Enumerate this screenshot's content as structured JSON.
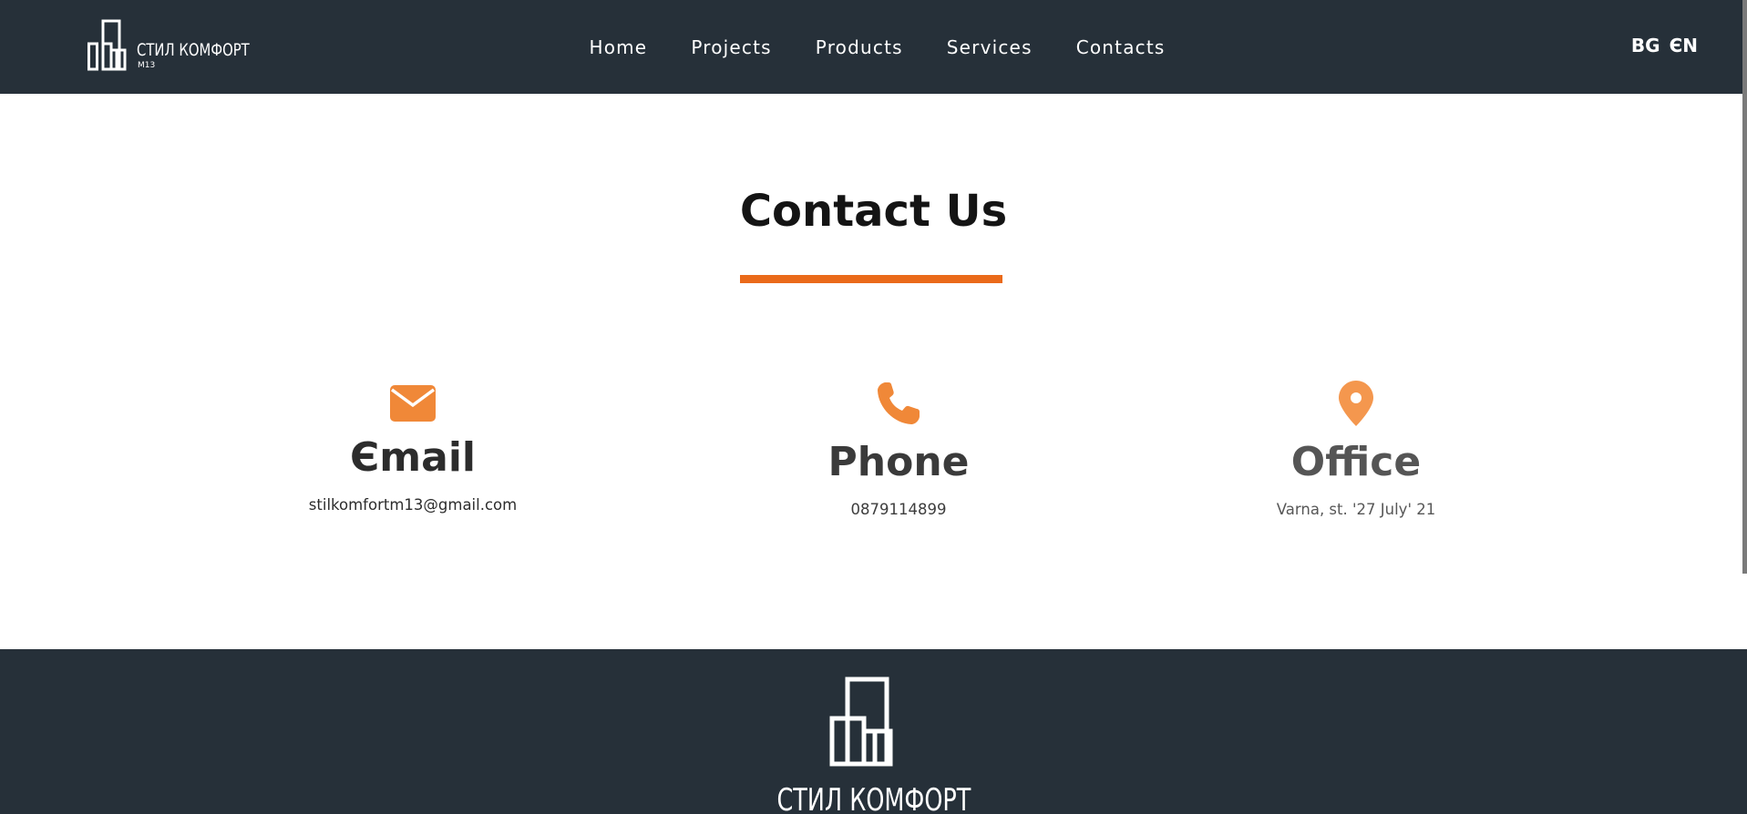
{
  "header": {
    "logo": {
      "text": "СТИЛ КОМФОРТ",
      "sub": "M13",
      "icon": "buildings-logo-icon"
    },
    "nav": [
      {
        "label": "Home"
      },
      {
        "label": "Projects"
      },
      {
        "label": "Products"
      },
      {
        "label": "Services"
      },
      {
        "label": "Contacts"
      }
    ],
    "languages": [
      "BG",
      "ЄN"
    ]
  },
  "contact": {
    "title": "Contact Us",
    "cards": [
      {
        "icon": "envelope-icon",
        "title": "Єmail",
        "value": "stilkomfortm13@gmail.com"
      },
      {
        "icon": "phone-icon",
        "title": "Phone",
        "value": "0879114899"
      },
      {
        "icon": "map-pin-icon",
        "title": "Office",
        "value": "Varna, st. '27 July' 21"
      }
    ]
  },
  "footer": {
    "logo_text": "СТИЛ КОМФОРТ",
    "icon": "buildings-logo-icon"
  },
  "colors": {
    "header_bg": "#263039",
    "accent": "#ea6a1a",
    "icon_orange": "#f08838",
    "footer_bg": "#263039"
  }
}
